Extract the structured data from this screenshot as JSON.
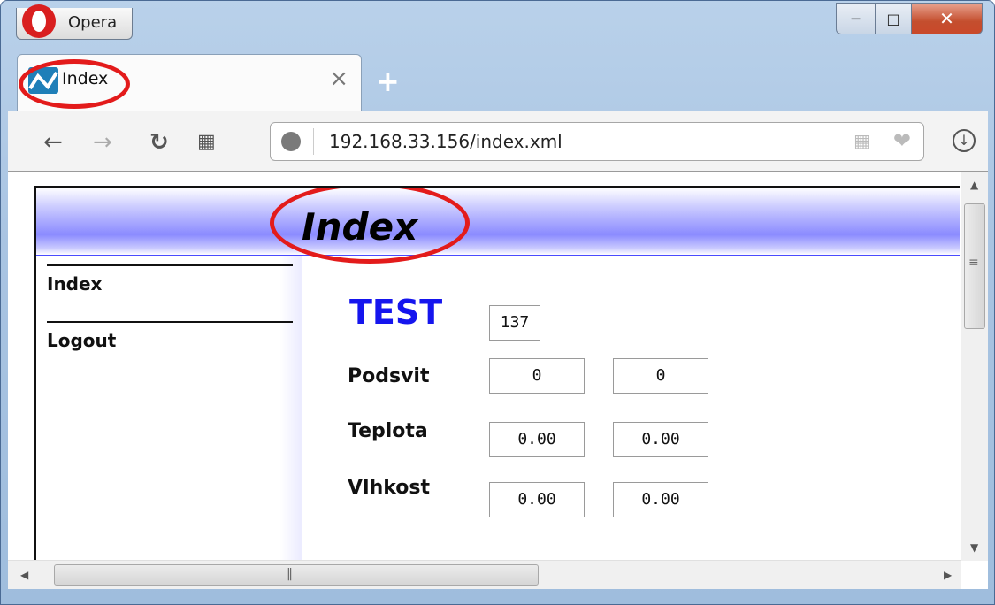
{
  "window": {
    "app_button_label": "Opera",
    "controls": {
      "minimize_icon": "minimize-icon",
      "maximize_icon": "maximize-icon",
      "close_icon": "close-icon"
    }
  },
  "tabs": [
    {
      "title": "Index",
      "active": true
    }
  ],
  "toolbar": {
    "address": "192.168.33.156/index.xml"
  },
  "page": {
    "banner_title": "Index",
    "sidebar": {
      "items": [
        {
          "label": "Index"
        },
        {
          "label": "Logout"
        }
      ]
    },
    "test": {
      "label": "TEST",
      "value": "137"
    },
    "rows": [
      {
        "label": "Podsvit",
        "value1": "0",
        "value2": "0"
      },
      {
        "label": "Teplota",
        "value1": "0.00",
        "value2": "0.00"
      },
      {
        "label": "Vlhkost",
        "value1": "0.00",
        "value2": "0.00"
      }
    ]
  },
  "colors": {
    "annotation_circle": "#e31b1b",
    "test_label": "#1515ee",
    "banner_blue": "#8b8bff"
  }
}
